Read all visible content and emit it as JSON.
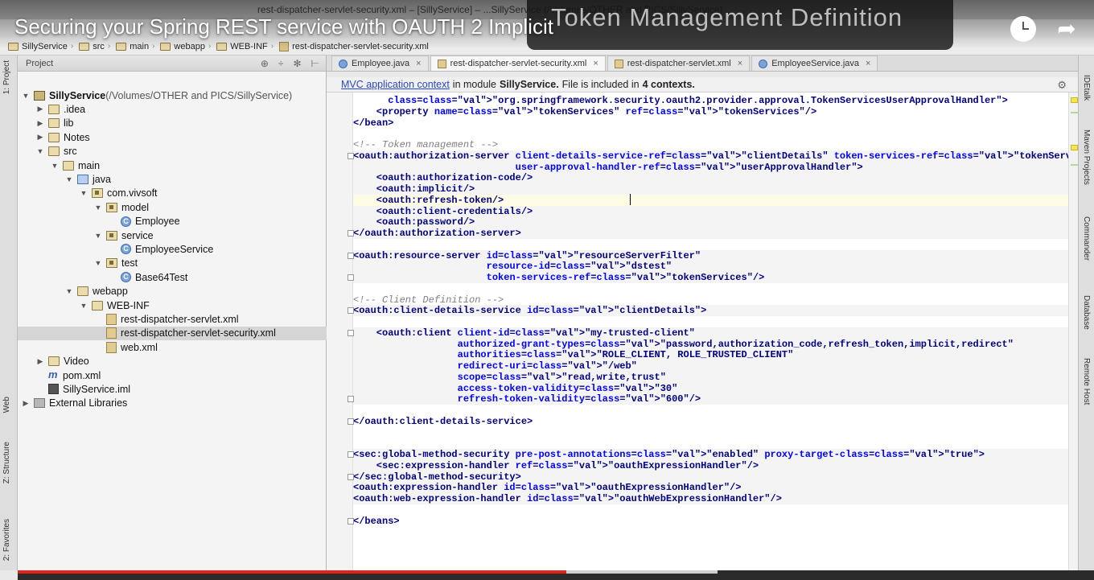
{
  "window": {
    "title": "rest-dispatcher-servlet-security.xml – [SillyService] – ...SillyService (/Volumes/OTHER and PICS/SillyService)"
  },
  "video": {
    "title": "Securing your Spring REST service with OAUTH 2 Implicit",
    "overlay_banner": "Token Management Definition",
    "watch_later_icon": "clock-icon",
    "share_icon": "share-arrow-icon",
    "progress_played": 0.51,
    "progress_buffered": 0.65
  },
  "breadcrumbs": [
    "SillyService",
    "src",
    "main",
    "webapp",
    "WEB-INF",
    "rest-dispatcher-servlet-security.xml"
  ],
  "left_strip": {
    "project": "1: Project",
    "web": "Web",
    "structure": "Z: Structure",
    "favorites": "2: Favorites"
  },
  "right_strip": {
    "idetalk": "IDEtalk",
    "maven": "Maven Projects",
    "commander": "Commander",
    "database": "Database",
    "remote": "Remote Host"
  },
  "project_panel": {
    "header": "Project",
    "tree": [
      {
        "label": "SillyService",
        "note": " (/Volumes/OTHER and PICS/SillyService)",
        "icon": "project",
        "arrow": "▼",
        "indent": 0
      },
      {
        "label": ".idea",
        "icon": "folder",
        "arrow": "▶",
        "indent": 1
      },
      {
        "label": "lib",
        "icon": "folder",
        "arrow": "▶",
        "indent": 1
      },
      {
        "label": "Notes",
        "icon": "folder",
        "arrow": "▶",
        "indent": 1
      },
      {
        "label": "src",
        "icon": "folder",
        "arrow": "▼",
        "indent": 1
      },
      {
        "label": "main",
        "icon": "folder",
        "arrow": "▼",
        "indent": 2
      },
      {
        "label": "java",
        "icon": "srcfolder",
        "arrow": "▼",
        "indent": 3
      },
      {
        "label": "com.vivsoft",
        "icon": "pkg",
        "arrow": "▼",
        "indent": 4
      },
      {
        "label": "model",
        "icon": "pkg",
        "arrow": "▼",
        "indent": 5
      },
      {
        "label": "Employee",
        "icon": "cls",
        "arrow": "",
        "indent": 6
      },
      {
        "label": "service",
        "icon": "pkg",
        "arrow": "▼",
        "indent": 5
      },
      {
        "label": "EmployeeService",
        "icon": "cls",
        "arrow": "",
        "indent": 6
      },
      {
        "label": "test",
        "icon": "pkg",
        "arrow": "▼",
        "indent": 5
      },
      {
        "label": "Base64Test",
        "icon": "cls",
        "arrow": "",
        "indent": 6
      },
      {
        "label": "webapp",
        "icon": "folder",
        "arrow": "▼",
        "indent": 3
      },
      {
        "label": "WEB-INF",
        "icon": "folder",
        "arrow": "▼",
        "indent": 4
      },
      {
        "label": "rest-dispatcher-servlet.xml",
        "icon": "xml",
        "arrow": "",
        "indent": 5
      },
      {
        "label": "rest-dispatcher-servlet-security.xml",
        "icon": "xml",
        "arrow": "",
        "indent": 5,
        "selected": true
      },
      {
        "label": "web.xml",
        "icon": "xml",
        "arrow": "",
        "indent": 5
      },
      {
        "label": "Video",
        "icon": "folder",
        "arrow": "▶",
        "indent": 1
      },
      {
        "label": "pom.xml",
        "icon": "mvn",
        "arrow": "",
        "indent": 1
      },
      {
        "label": "SillyService.iml",
        "icon": "iml",
        "arrow": "",
        "indent": 1
      },
      {
        "label": "External Libraries",
        "icon": "lib",
        "arrow": "▶",
        "indent": 0
      }
    ]
  },
  "editor_tabs": [
    {
      "label": "Employee.java",
      "icon": "class",
      "active": false
    },
    {
      "label": "rest-dispatcher-servlet-security.xml",
      "icon": "xml",
      "active": true
    },
    {
      "label": "rest-dispatcher-servlet.xml",
      "icon": "xml",
      "active": false
    },
    {
      "label": "EmployeeService.java",
      "icon": "class",
      "active": false
    }
  ],
  "info_bar": {
    "link": "MVC application context",
    "text_a": "in module",
    "module": "SillyService.",
    "text_b": "File is included in",
    "contexts": "4 contexts."
  },
  "code_lines": [
    "      class=\"org.springframework.security.oauth2.provider.approval.TokenServicesUserApprovalHandler\">",
    "    <property name=\"tokenServices\" ref=\"tokenServices\"/>",
    "</bean>",
    "",
    "<!-- Token management -->",
    "<oauth:authorization-server client-details-service-ref=\"clientDetails\" token-services-ref=\"tokenServices\"",
    "                            user-approval-handler-ref=\"userApprovalHandler\">",
    "    <oauth:authorization-code/>",
    "    <oauth:implicit/>",
    "    <oauth:refresh-token/>",
    "    <oauth:client-credentials/>",
    "    <oauth:password/>",
    "</oauth:authorization-server>",
    "",
    "<oauth:resource-server id=\"resourceServerFilter\"",
    "                       resource-id=\"dstest\"",
    "                       token-services-ref=\"tokenServices\"/>",
    "",
    "<!-- Client Definition -->",
    "<oauth:client-details-service id=\"clientDetails\">",
    "",
    "    <oauth:client client-id=\"my-trusted-client\"",
    "                  authorized-grant-types=\"password,authorization_code,refresh_token,implicit,redirect\"",
    "                  authorities=\"ROLE_CLIENT, ROLE_TRUSTED_CLIENT\"",
    "                  redirect-uri=\"/web\"",
    "                  scope=\"read,write,trust\"",
    "                  access-token-validity=\"30\"",
    "                  refresh-token-validity=\"600\"/>",
    "",
    "</oauth:client-details-service>",
    "",
    "",
    "<sec:global-method-security pre-post-annotations=\"enabled\" proxy-target-class=\"true\">",
    "    <sec:expression-handler ref=\"oauthExpressionHandler\"/>",
    "</sec:global-method-security>",
    "<oauth:expression-handler id=\"oauthExpressionHandler\"/>",
    "<oauth:web-expression-handler id=\"oauthWebExpressionHandler\"/>",
    "",
    "</beans>"
  ],
  "colors": {
    "tag": "#000080",
    "attr": "#0000ff",
    "value": "#008000",
    "comment": "#808080",
    "progress": "#e62117"
  }
}
